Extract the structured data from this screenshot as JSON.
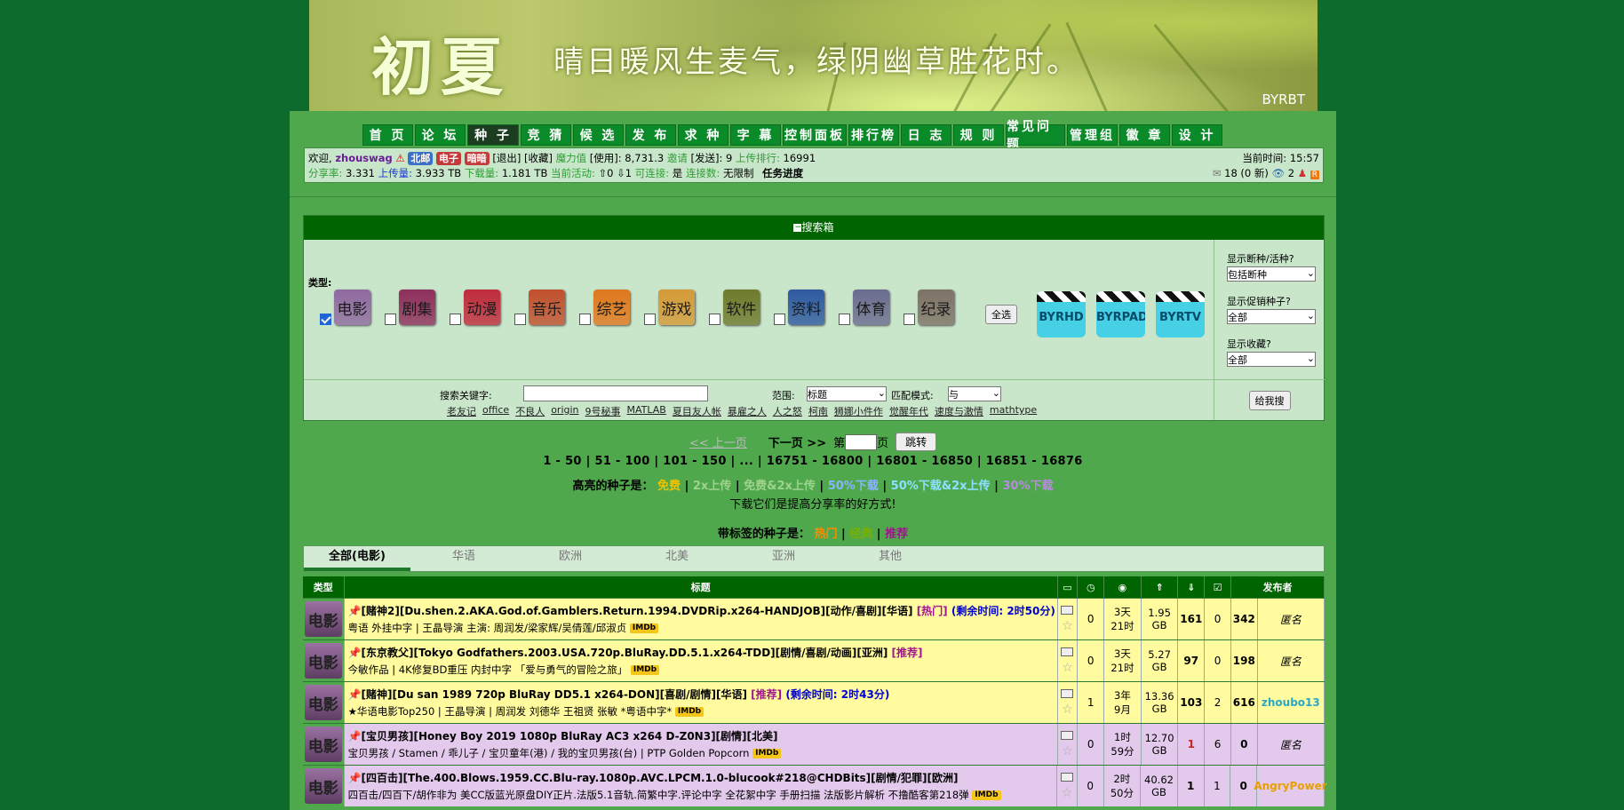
{
  "banner": {
    "logo": "初夏",
    "slogan": "晴日暖风生麦气，绿阴幽草胜花时。",
    "site": "BYRBT"
  },
  "nav": [
    "首 页",
    "论 坛",
    "种 子",
    "竞 猜",
    "候 选",
    "发 布",
    "求 种",
    "字 幕",
    "控制面板",
    "排行榜",
    "日 志",
    "规 则",
    "常见问题",
    "管理组",
    "徽 章",
    "设 计"
  ],
  "nav_active": 2,
  "user": {
    "welcome": "欢迎,",
    "name": "zhouswag",
    "tags": [
      "北邮",
      "电子",
      "暗暗"
    ],
    "logout": "[退出]",
    "fav": "[收藏]",
    "magic_label": "魔力值",
    "magic_use": "[使用]:",
    "magic": "8,731.3",
    "invite_label": "邀请",
    "invite_send": "[发送]:",
    "invite": "9",
    "upload_rank_label": "上传排行:",
    "upload_rank": "16991",
    "ratio_label": "分享率:",
    "ratio": "3.331",
    "up_label": "上传量:",
    "up": "3.933 TB",
    "down_label": "下载量:",
    "down": "1.181 TB",
    "active_label": "当前活动:",
    "active": "⇧0 ⇩1",
    "connect_label": "可连接:",
    "connect": "是",
    "conn_limit_label": "连接数:",
    "conn_limit": "无限制",
    "task": "任务进度",
    "time_label": "当前时间:",
    "time": "15:57",
    "msgs": "18 (0 新)",
    "watch": "2"
  },
  "search": {
    "header": "搜索箱",
    "type_label": "类型:",
    "categories": [
      {
        "name": "电影",
        "color": "#8f6aa0",
        "checked": true
      },
      {
        "name": "剧集",
        "color": "#8e2f5b",
        "checked": false
      },
      {
        "name": "动漫",
        "color": "#c02b3a",
        "checked": false
      },
      {
        "name": "音乐",
        "color": "#c1502d",
        "checked": false
      },
      {
        "name": "综艺",
        "color": "#e0781d",
        "checked": false
      },
      {
        "name": "游戏",
        "color": "#d49a36",
        "checked": false
      },
      {
        "name": "软件",
        "color": "#6e7a2c",
        "checked": false
      },
      {
        "name": "资料",
        "color": "#2f5aa0",
        "checked": false
      },
      {
        "name": "体育",
        "color": "#6b6d8f",
        "checked": false
      },
      {
        "name": "纪录",
        "color": "#7e7266",
        "checked": false
      }
    ],
    "select_all": "全选",
    "channels": [
      "BYRHD",
      "BYRPAD",
      "BYRTV"
    ],
    "opt1_label": "显示断种/活种?",
    "opt1": "包括断种",
    "opt2_label": "显示促销种子?",
    "opt2": "全部",
    "opt3_label": "显示收藏?",
    "opt3": "全部",
    "keyword_label": "搜索关键字:",
    "keyword": "",
    "scope_label": "范围:",
    "scope": "标题",
    "mode_label": "匹配模式:",
    "mode": "与",
    "hot": [
      "老友记",
      "office",
      "不良人",
      "origin",
      "9号秘事",
      "MATLAB",
      "夏目友人帐",
      "暴雇之人",
      "人之怒",
      "柯南",
      "狮娜小件作",
      "觉醒年代",
      "速度与激情",
      "mathtype"
    ],
    "go": "给我搜"
  },
  "pager": {
    "prev": "<< 上一页",
    "next": "下一页 >>",
    "page_prefix": "第",
    "page_suffix": "页",
    "jump": "跳转",
    "pages": "1 - 50 | 51 - 100 | 101 - 150 | ... | 16751 - 16800 | 16801 - 16850 | 16851 - 16876"
  },
  "legend": {
    "label": "高亮的种子是：",
    "items": [
      {
        "t": "免费",
        "c": "#f2c200"
      },
      {
        "t": "2x上传",
        "c": "#9fd28e"
      },
      {
        "t": "免费&2x上传",
        "c": "#9fd28e"
      },
      {
        "t": "50%下载",
        "c": "#8ab4ff"
      },
      {
        "t": "50%下载&2x上传",
        "c": "#8ce0ff"
      },
      {
        "t": "30%下载",
        "c": "#b98ae0"
      }
    ],
    "note": "下载它们是提高分享率的好方式!",
    "tag_label": "带标签的种子是：",
    "tags": [
      {
        "t": "热门",
        "c": "#ff8c00"
      },
      {
        "t": "经典",
        "c": "#7ab000"
      },
      {
        "t": "推荐",
        "c": "#a0158c"
      }
    ]
  },
  "tabs": [
    "全部(电影)",
    "华语",
    "欧洲",
    "北美",
    "亚洲",
    "其他"
  ],
  "table": {
    "headers": [
      "类型",
      "标题",
      "",
      "",
      "",
      "",
      "",
      "",
      "",
      "发布者"
    ],
    "rows": [
      {
        "cat": "电影",
        "title": "[赌神2][Du.shen.2.AKA.God.of.Gamblers.Return.1994.DVDRip.x264-HANDJOB][动作/喜剧][华语]",
        "tag": "[热门]",
        "extra": "(剩余时间: 2时50分)",
        "sub": "粤语 外挂中字 | 王晶导演 主演: 周润发/梁家辉/吴倩莲/邱淑贞",
        "comments": "0",
        "time": "3天\n21时",
        "size": "1.95\nGB",
        "seeders": "161",
        "leechers": "0",
        "done": "342",
        "uploader": "匿名",
        "bg": "#fffb9e"
      },
      {
        "cat": "电影",
        "title": "[东京教父][Tokyo Godfathers.2003.USA.720p.BluRay.DD.5.1.x264-TDD][剧情/喜剧/动画][亚洲]",
        "tag": "[推荐]",
        "extra": "",
        "sub": "今敏作品 | 4K修复BD重压 内封中字 「爱与勇气的冒险之旅」",
        "comments": "0",
        "time": "3天\n21时",
        "size": "5.27\nGB",
        "seeders": "97",
        "leechers": "0",
        "done": "198",
        "uploader": "匿名",
        "bg": "#fffb9e"
      },
      {
        "cat": "电影",
        "title": "[赌神][Du san 1989 720p BluRay DD5.1 x264-DON][喜剧/剧情][华语]",
        "tag": "[推荐]",
        "extra": "(剩余时间: 2时43分)",
        "sub": "★华语电影Top250 | 王晶导演 | 周润发 刘德华 王祖贤 张敏 *粤语中字*",
        "comments": "1",
        "time": "3年\n9月",
        "size": "13.36\nGB",
        "seeders": "103",
        "leechers": "2",
        "done": "616",
        "uploader": "zhoubo13",
        "bg": "#fffb9e"
      },
      {
        "cat": "电影",
        "title": "[宝贝男孩][Honey Boy 2019 1080p BluRay AC3 x264 D-Z0N3][剧情][北美]",
        "tag": "",
        "extra": "",
        "sub": "宝贝男孩 / Stamen / 乖儿子 / 宝贝童年(港) / 我的宝贝男孩(台) | PTP Golden Popcorn",
        "comments": "0",
        "time": "1时\n59分",
        "size": "12.70\nGB",
        "seeders": "1",
        "leechers": "6",
        "done": "0",
        "uploader": "匿名",
        "bg": "#e3c9ec"
      },
      {
        "cat": "电影",
        "title": "[四百击][The.400.Blows.1959.CC.Blu-ray.1080p.AVC.LPCM.1.0-blucook#218@CHDBits][剧情/犯罪][欧洲]",
        "tag": "",
        "extra": "",
        "sub": "四百击/四百下/胡作非为 美CC版蓝光原盘DIY正片.法版5.1音轨.简繁中字.评论中字 全花絮中字 手册扫描 法版影片解析 不撸酷客第218弹",
        "comments": "0",
        "time": "2时\n50分",
        "size": "40.62\nGB",
        "seeders": "1",
        "leechers": "1",
        "done": "0",
        "uploader": "AngryPower",
        "bg": "#e3c9ec"
      }
    ]
  }
}
